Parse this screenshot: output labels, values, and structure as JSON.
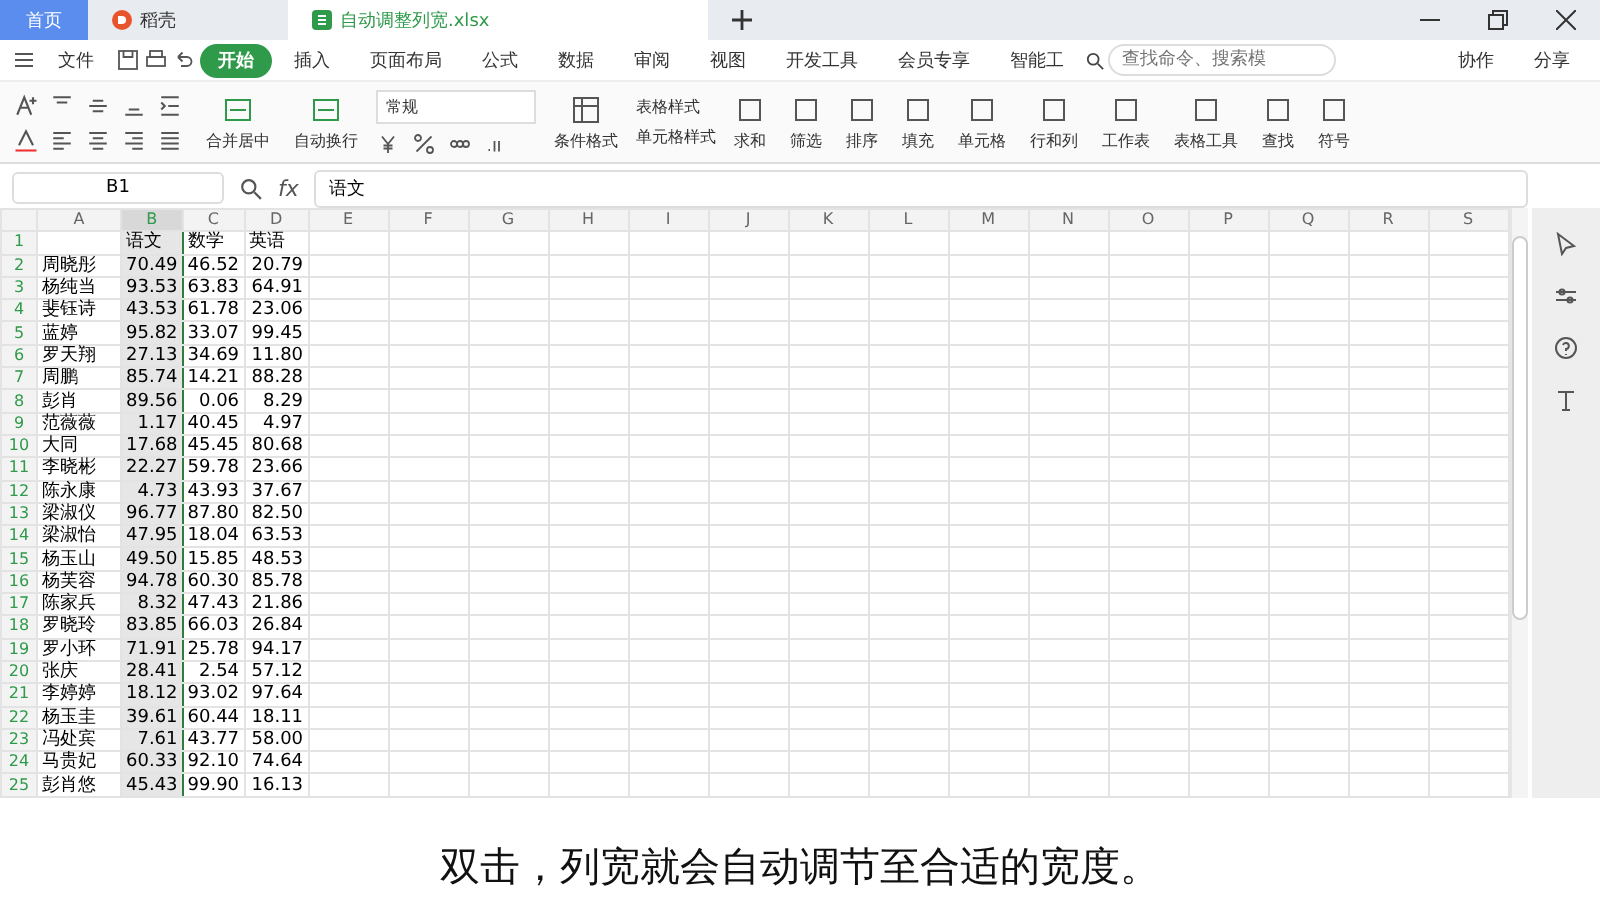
{
  "window_tabs": [
    {
      "label": "首页",
      "selected": false,
      "kind": "home"
    },
    {
      "label": "稻壳",
      "selected": false,
      "kind": "app"
    },
    {
      "label": "自动调整列宽.xlsx",
      "selected": true,
      "kind": "doc"
    }
  ],
  "menu": {
    "file": "文件",
    "items": [
      {
        "label": "开始",
        "selected": true
      },
      {
        "label": "插入",
        "selected": false
      },
      {
        "label": "页面布局",
        "selected": false
      },
      {
        "label": "公式",
        "selected": false
      },
      {
        "label": "数据",
        "selected": false
      },
      {
        "label": "审阅",
        "selected": false
      },
      {
        "label": "视图",
        "selected": false
      },
      {
        "label": "开发工具",
        "selected": false
      },
      {
        "label": "会员专享",
        "selected": false
      },
      {
        "label": "智能工",
        "selected": false
      }
    ],
    "search": {
      "placeholder": "查找命令、搜索模"
    },
    "actions": [
      "协作",
      "分享"
    ]
  },
  "ribbon": {
    "merge": [
      "合并居中",
      "自动换行"
    ],
    "format": "常规",
    "styles": [
      "表格样式",
      "单元格样式"
    ],
    "conditional": "条件格式",
    "tools": [
      "求和",
      "筛选",
      "排序",
      "填充",
      "单元格",
      "行和列",
      "工作表",
      "表格工具",
      "查找",
      "符号"
    ]
  },
  "formula_bar": {
    "cell": "B1",
    "function_label": "fx",
    "value": "语文"
  },
  "columns": [
    {
      "label": "A",
      "selected": false
    },
    {
      "label": "B",
      "selected": true
    },
    {
      "label": "C",
      "selected": false
    },
    {
      "label": "D",
      "selected": false
    },
    {
      "label": "E",
      "selected": false
    },
    {
      "label": "F",
      "selected": false
    },
    {
      "label": "G",
      "selected": false
    },
    {
      "label": "H",
      "selected": false
    },
    {
      "label": "I",
      "selected": false
    },
    {
      "label": "J",
      "selected": false
    },
    {
      "label": "K",
      "selected": false
    },
    {
      "label": "L",
      "selected": false
    },
    {
      "label": "M",
      "selected": false
    },
    {
      "label": "N",
      "selected": false
    },
    {
      "label": "O",
      "selected": false
    },
    {
      "label": "P",
      "selected": false
    },
    {
      "label": "Q",
      "selected": false
    },
    {
      "label": "R",
      "selected": false
    },
    {
      "label": "S",
      "selected": false
    }
  ],
  "rows": [
    [
      "1",
      "",
      "语文",
      "数学",
      "英语"
    ],
    [
      "2",
      "周晓彤",
      "70.49",
      "46.52",
      "20.79"
    ],
    [
      "3",
      "杨纯当",
      "93.53",
      "63.83",
      "64.91"
    ],
    [
      "4",
      "斐钰诗",
      "43.53",
      "61.78",
      "23.06"
    ],
    [
      "5",
      "蓝婷",
      "95.82",
      "33.07",
      "99.45"
    ],
    [
      "6",
      "罗天翔",
      "27.13",
      "34.69",
      "11.80"
    ],
    [
      "7",
      "周鹏",
      "85.74",
      "14.21",
      "88.28"
    ],
    [
      "8",
      "彭肖",
      "89.56",
      "0.06",
      "8.29"
    ],
    [
      "9",
      "范薇薇",
      "1.17",
      "40.45",
      "4.97"
    ],
    [
      "10",
      "大同",
      "17.68",
      "45.45",
      "80.68"
    ],
    [
      "11",
      "李晓彬",
      "22.27",
      "59.78",
      "23.66"
    ],
    [
      "12",
      "陈永康",
      "4.73",
      "43.93",
      "37.67"
    ],
    [
      "13",
      "梁淑仪",
      "96.77",
      "87.80",
      "82.50"
    ],
    [
      "14",
      "梁淑怡",
      "47.95",
      "18.04",
      "63.53"
    ],
    [
      "15",
      "杨玉山",
      "49.50",
      "15.85",
      "48.53"
    ],
    [
      "16",
      "杨芙容",
      "94.78",
      "60.30",
      "85.78"
    ],
    [
      "17",
      "陈家兵",
      "8.32",
      "47.43",
      "21.86"
    ],
    [
      "18",
      "罗晓玲",
      "83.85",
      "66.03",
      "26.84"
    ],
    [
      "19",
      "罗小环",
      "71.91",
      "25.78",
      "94.17"
    ],
    [
      "20",
      "张庆",
      "28.41",
      "2.54",
      "57.12"
    ],
    [
      "21",
      "李婷婷",
      "18.12",
      "93.02",
      "97.64"
    ],
    [
      "22",
      "杨玉圭",
      "39.61",
      "60.44",
      "18.11"
    ],
    [
      "23",
      "冯处宾",
      "7.61",
      "43.77",
      "58.00"
    ],
    [
      "24",
      "马贵妃",
      "60.33",
      "92.10",
      "74.64"
    ],
    [
      "25",
      "彭肖悠",
      "45.43",
      "99.90",
      "16.13"
    ]
  ],
  "subtitle": "双击，列宽就会自动调节至合适的宽度。"
}
